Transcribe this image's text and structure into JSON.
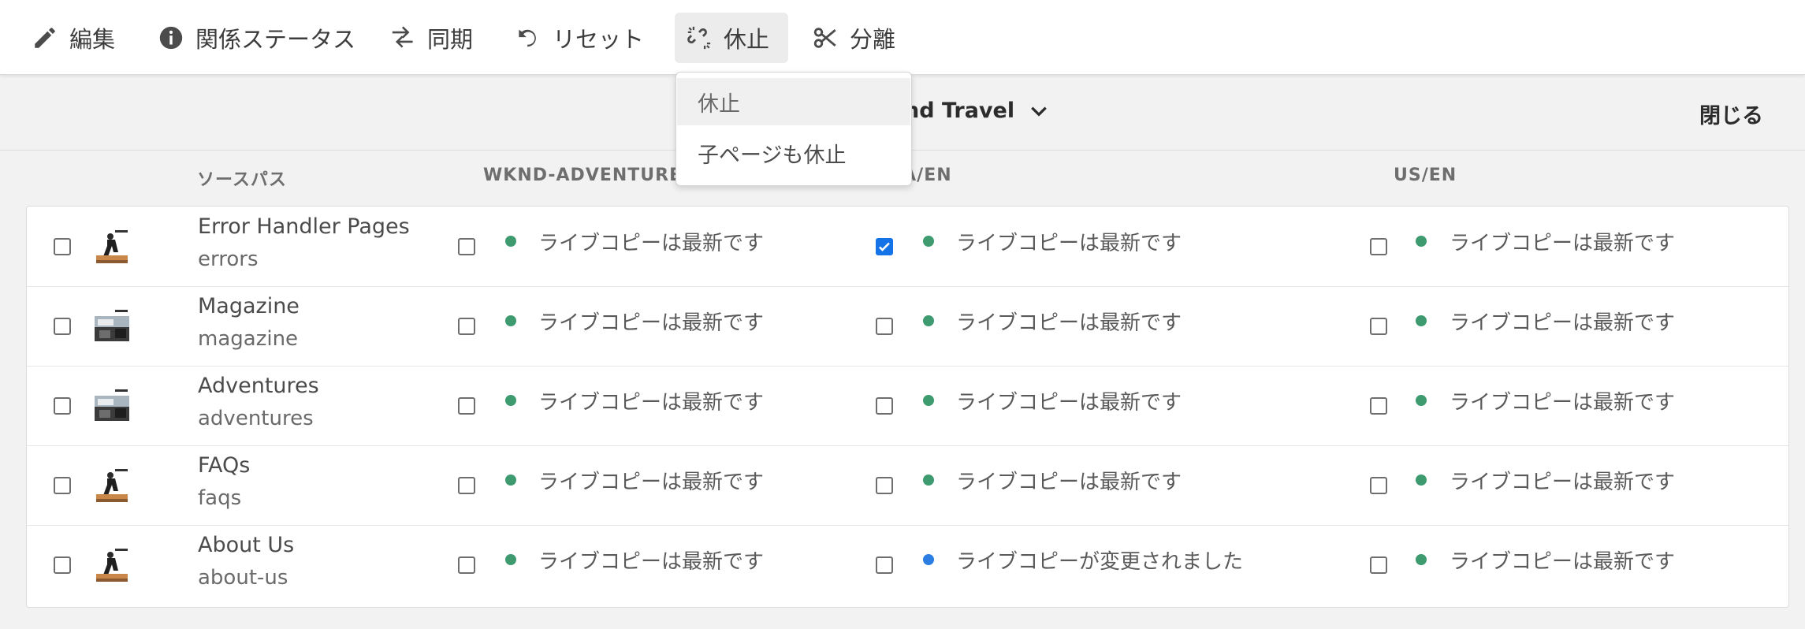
{
  "toolbar": {
    "edit": "編集",
    "relationship_status": "関係ステータス",
    "sync": "同期",
    "reset": "リセット",
    "suspend": "休止",
    "detach": "分離"
  },
  "suspend_menu": {
    "items": [
      "休止",
      "子ページも休止"
    ]
  },
  "header": {
    "selector_label": "es and Travel",
    "close_label": "閉じる"
  },
  "columns": {
    "source_path": "ソースパス",
    "col1": "WKND-ADVENTURES",
    "col2": "CA/EN",
    "col3": "US/EN"
  },
  "colors": {
    "status_current": "#3d9b6f",
    "status_modified": "#2b7de1",
    "checkbox_checked": "#1473e6"
  },
  "rows": [
    {
      "title": "Error Handler Pages",
      "path": "errors",
      "thumb": "person-thumbnail",
      "statuses": [
        {
          "text": "ライブコピーは最新です",
          "state": "current",
          "checked": false
        },
        {
          "text": "ライブコピーは最新です",
          "state": "current",
          "checked": true
        },
        {
          "text": "ライブコピーは最新です",
          "state": "current",
          "checked": false
        }
      ]
    },
    {
      "title": "Magazine",
      "path": "magazine",
      "thumb": "scene-thumbnail",
      "statuses": [
        {
          "text": "ライブコピーは最新です",
          "state": "current",
          "checked": false
        },
        {
          "text": "ライブコピーは最新です",
          "state": "current",
          "checked": false
        },
        {
          "text": "ライブコピーは最新です",
          "state": "current",
          "checked": false
        }
      ]
    },
    {
      "title": "Adventures",
      "path": "adventures",
      "thumb": "scene-thumbnail",
      "statuses": [
        {
          "text": "ライブコピーは最新です",
          "state": "current",
          "checked": false
        },
        {
          "text": "ライブコピーは最新です",
          "state": "current",
          "checked": false
        },
        {
          "text": "ライブコピーは最新です",
          "state": "current",
          "checked": false
        }
      ]
    },
    {
      "title": "FAQs",
      "path": "faqs",
      "thumb": "person-thumbnail",
      "statuses": [
        {
          "text": "ライブコピーは最新です",
          "state": "current",
          "checked": false
        },
        {
          "text": "ライブコピーは最新です",
          "state": "current",
          "checked": false
        },
        {
          "text": "ライブコピーは最新です",
          "state": "current",
          "checked": false
        }
      ]
    },
    {
      "title": "About Us",
      "path": "about-us",
      "thumb": "person-thumbnail",
      "statuses": [
        {
          "text": "ライブコピーは最新です",
          "state": "current",
          "checked": false
        },
        {
          "text": "ライブコピーが変更されました",
          "state": "modified",
          "checked": false
        },
        {
          "text": "ライブコピーは最新です",
          "state": "current",
          "checked": false
        }
      ]
    }
  ]
}
